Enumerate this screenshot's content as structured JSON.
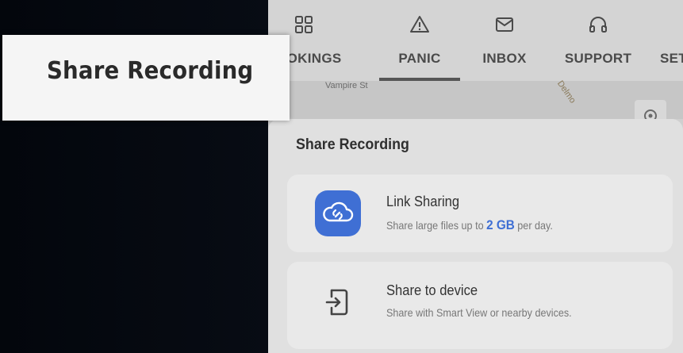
{
  "callout": {
    "title": "Share Recording"
  },
  "nav": {
    "items": [
      {
        "label": "BOOKINGS",
        "icon": "grid-icon"
      },
      {
        "label": "PANIC",
        "icon": "warning-triangle-icon"
      },
      {
        "label": "INBOX",
        "icon": "mail-icon"
      },
      {
        "label": "SUPPORT",
        "icon": "headphones-icon"
      },
      {
        "label": "SETTINGS",
        "icon": "gear-icon"
      }
    ],
    "active": "PANIC"
  },
  "map": {
    "street": "Vampire St",
    "road": "Delmo"
  },
  "sheet": {
    "title": "Share Recording",
    "options": [
      {
        "title": "Link Sharing",
        "desc_before": "Share large files up to",
        "desc_highlight": "2 GB",
        "desc_after": "per day.",
        "icon": "cloud-link-icon"
      },
      {
        "title": "Share to device",
        "desc": "Share with Smart View or nearby devices.",
        "icon": "share-device-icon"
      }
    ]
  },
  "colors": {
    "accent": "#3f6fd4",
    "background": "#05070c",
    "sheet": "#e0e0e0"
  }
}
